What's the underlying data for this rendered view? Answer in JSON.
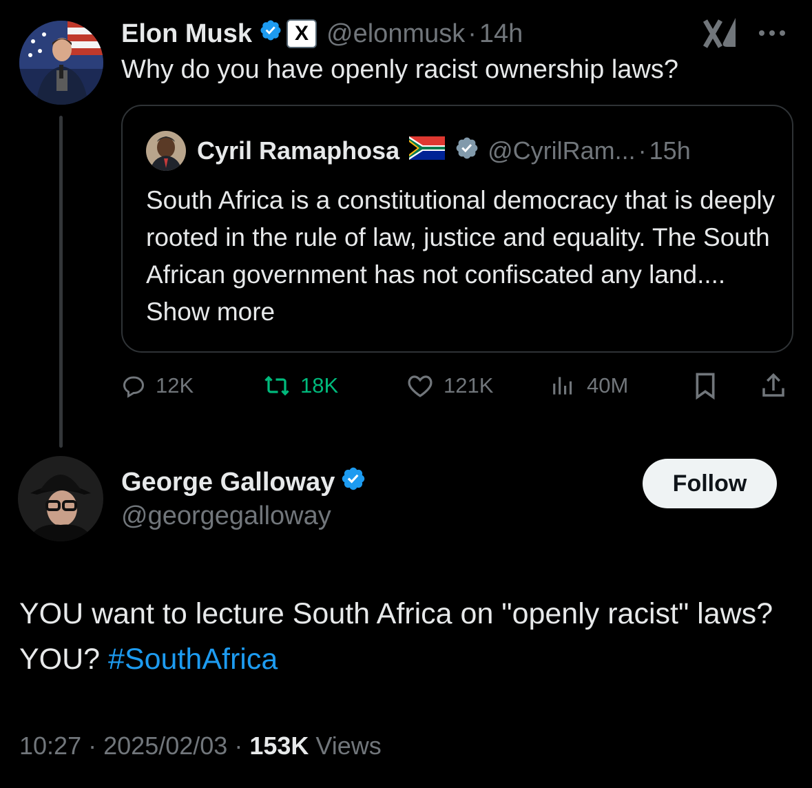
{
  "colors": {
    "background": "#000000",
    "text": "#e7e9ea",
    "muted": "#71767b",
    "verified": "#1d9bf0",
    "retweet": "#00ba7c",
    "link": "#1d9bf0",
    "border": "#2f3336"
  },
  "parent_tweet": {
    "author_name": "Elon Musk",
    "author_handle": "@elonmusk",
    "separator": "·",
    "time_ago": "14h",
    "affiliate_badge": "X",
    "text": "Why do you have openly racist ownership laws?",
    "icons": [
      "verified-badge-icon",
      "grok-icon",
      "more-options-icon"
    ],
    "quoted": {
      "author_name": "Cyril Ramaphosa",
      "flag": "🇿🇦",
      "author_handle": "@CyrilRam...",
      "separator": "·",
      "time_ago": "15h",
      "text": "South Africa is a constitutional democracy that is deeply rooted in the rule of law, justice and equality. The South African government has not confiscated any land....",
      "show_more": "Show more"
    },
    "actions": {
      "replies": "12K",
      "retweets": "18K",
      "likes": "121K",
      "views": "40M"
    }
  },
  "reply_tweet": {
    "author_name": "George Galloway",
    "author_handle": "@georgegalloway",
    "follow_label": "Follow",
    "text_before": "YOU want to lecture South Africa on \"openly racist\" laws? YOU? ",
    "hashtag": "#SouthAfrica",
    "time": "10:27",
    "separator": "·",
    "date": "2025/02/03",
    "views_count": "153K",
    "views_label": "Views"
  }
}
